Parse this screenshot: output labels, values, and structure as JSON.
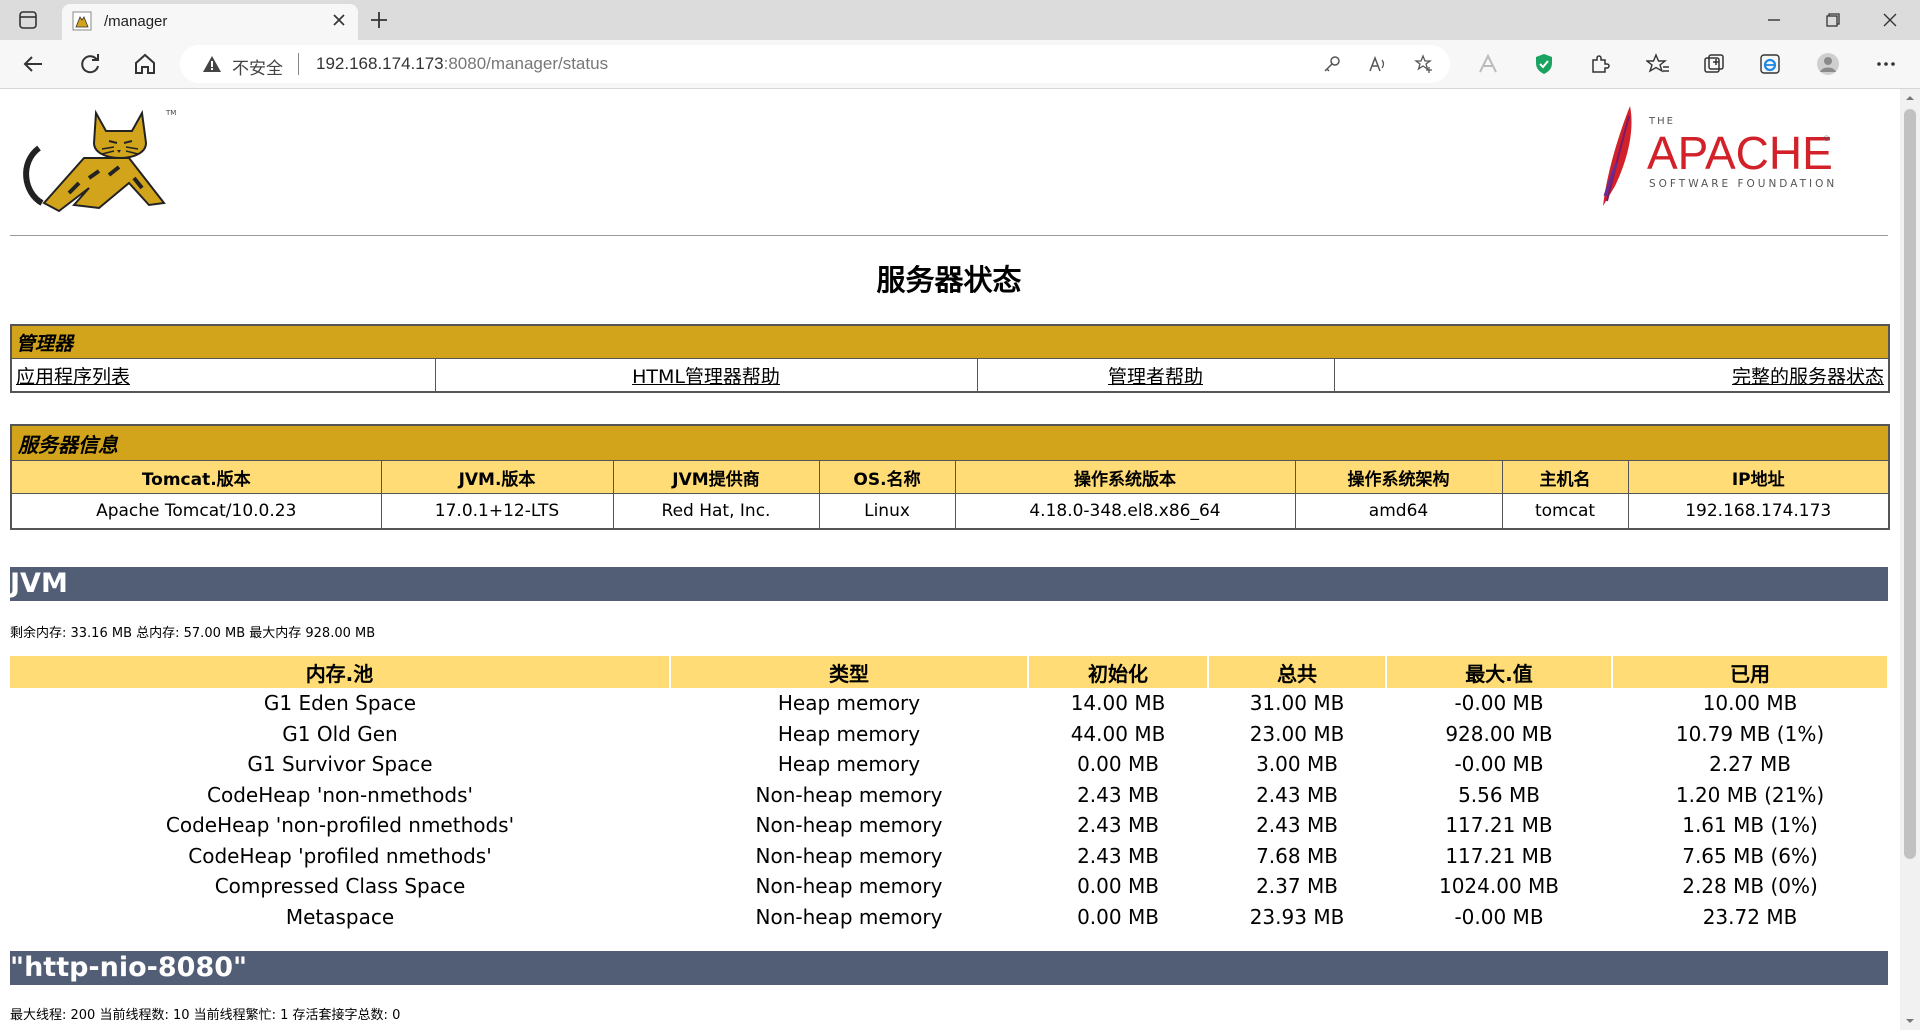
{
  "browser": {
    "tab_title": "/manager",
    "address_insecure": "不安全",
    "address_host": "192.168.174.173",
    "address_path": ":8080/manager/status",
    "icons": [
      "tab-toggle-icon",
      "tomcat-favicon-icon",
      "close-icon",
      "plus-icon",
      "back-icon",
      "refresh-icon",
      "home-icon",
      "warning-icon",
      "key-icon",
      "read-aloud-icon",
      "favorite-add-icon",
      "extension-a-icon",
      "shield-icon",
      "puzzle-icon",
      "favorites-icon",
      "collections-icon",
      "edge-icon",
      "profile-icon",
      "more-icon",
      "minimize-icon",
      "maximize-icon",
      "window-close-icon"
    ]
  },
  "page": {
    "title": "服务器状态",
    "manager": {
      "header": "管理器",
      "links": [
        "应用程序列表",
        "HTML管理器帮助",
        "管理者帮助",
        "完整的服务器状态"
      ]
    },
    "server_info": {
      "header": "服务器信息",
      "columns": [
        "Tomcat.版本",
        "JVM.版本",
        "JVM提供商",
        "OS.名称",
        "操作系统版本",
        "操作系统架构",
        "主机名",
        "IP地址"
      ],
      "values": [
        "Apache Tomcat/10.0.23",
        "17.0.1+12-LTS",
        "Red Hat, Inc.",
        "Linux",
        "4.18.0-348.el8.x86_64",
        "amd64",
        "tomcat",
        "192.168.174.173"
      ]
    },
    "jvm": {
      "band": "JVM",
      "memory_line": "剩余内存:   33.16 MB 总内存:   57.00 MB 最大内存 928.00 MB",
      "pool_columns": [
        "内存.池",
        "类型",
        "初始化",
        "总共",
        "最大.值",
        "已用"
      ],
      "pools": [
        [
          "G1 Eden Space",
          "Heap memory",
          "14.00 MB",
          "31.00 MB",
          "-0.00 MB",
          "10.00 MB"
        ],
        [
          "G1 Old Gen",
          "Heap memory",
          "44.00 MB",
          "23.00 MB",
          "928.00 MB",
          "10.79 MB (1%)"
        ],
        [
          "G1 Survivor Space",
          "Heap memory",
          "0.00 MB",
          "3.00 MB",
          "-0.00 MB",
          "2.27 MB"
        ],
        [
          "CodeHeap 'non-nmethods'",
          "Non-heap memory",
          "2.43 MB",
          "2.43 MB",
          "5.56 MB",
          "1.20 MB (21%)"
        ],
        [
          "CodeHeap 'non-profiled nmethods'",
          "Non-heap memory",
          "2.43 MB",
          "2.43 MB",
          "117.21 MB",
          "1.61 MB (1%)"
        ],
        [
          "CodeHeap 'profiled nmethods'",
          "Non-heap memory",
          "2.43 MB",
          "7.68 MB",
          "117.21 MB",
          "7.65 MB (6%)"
        ],
        [
          "Compressed Class Space",
          "Non-heap memory",
          "0.00 MB",
          "2.37 MB",
          "1024.00 MB",
          "2.28 MB (0%)"
        ],
        [
          "Metaspace",
          "Non-heap memory",
          "0.00 MB",
          "23.93 MB",
          "-0.00 MB",
          "23.72 MB"
        ]
      ]
    },
    "connector": {
      "band": "\"http-nio-8080\"",
      "thread_line": "最大线程:  200 当前线程数:  10 当前线程繁忙:  1 存活套接字总数:  0"
    },
    "colors": {
      "section_header": "#d2a41c",
      "column_header": "#ffdc75",
      "band": "#525d76"
    }
  }
}
